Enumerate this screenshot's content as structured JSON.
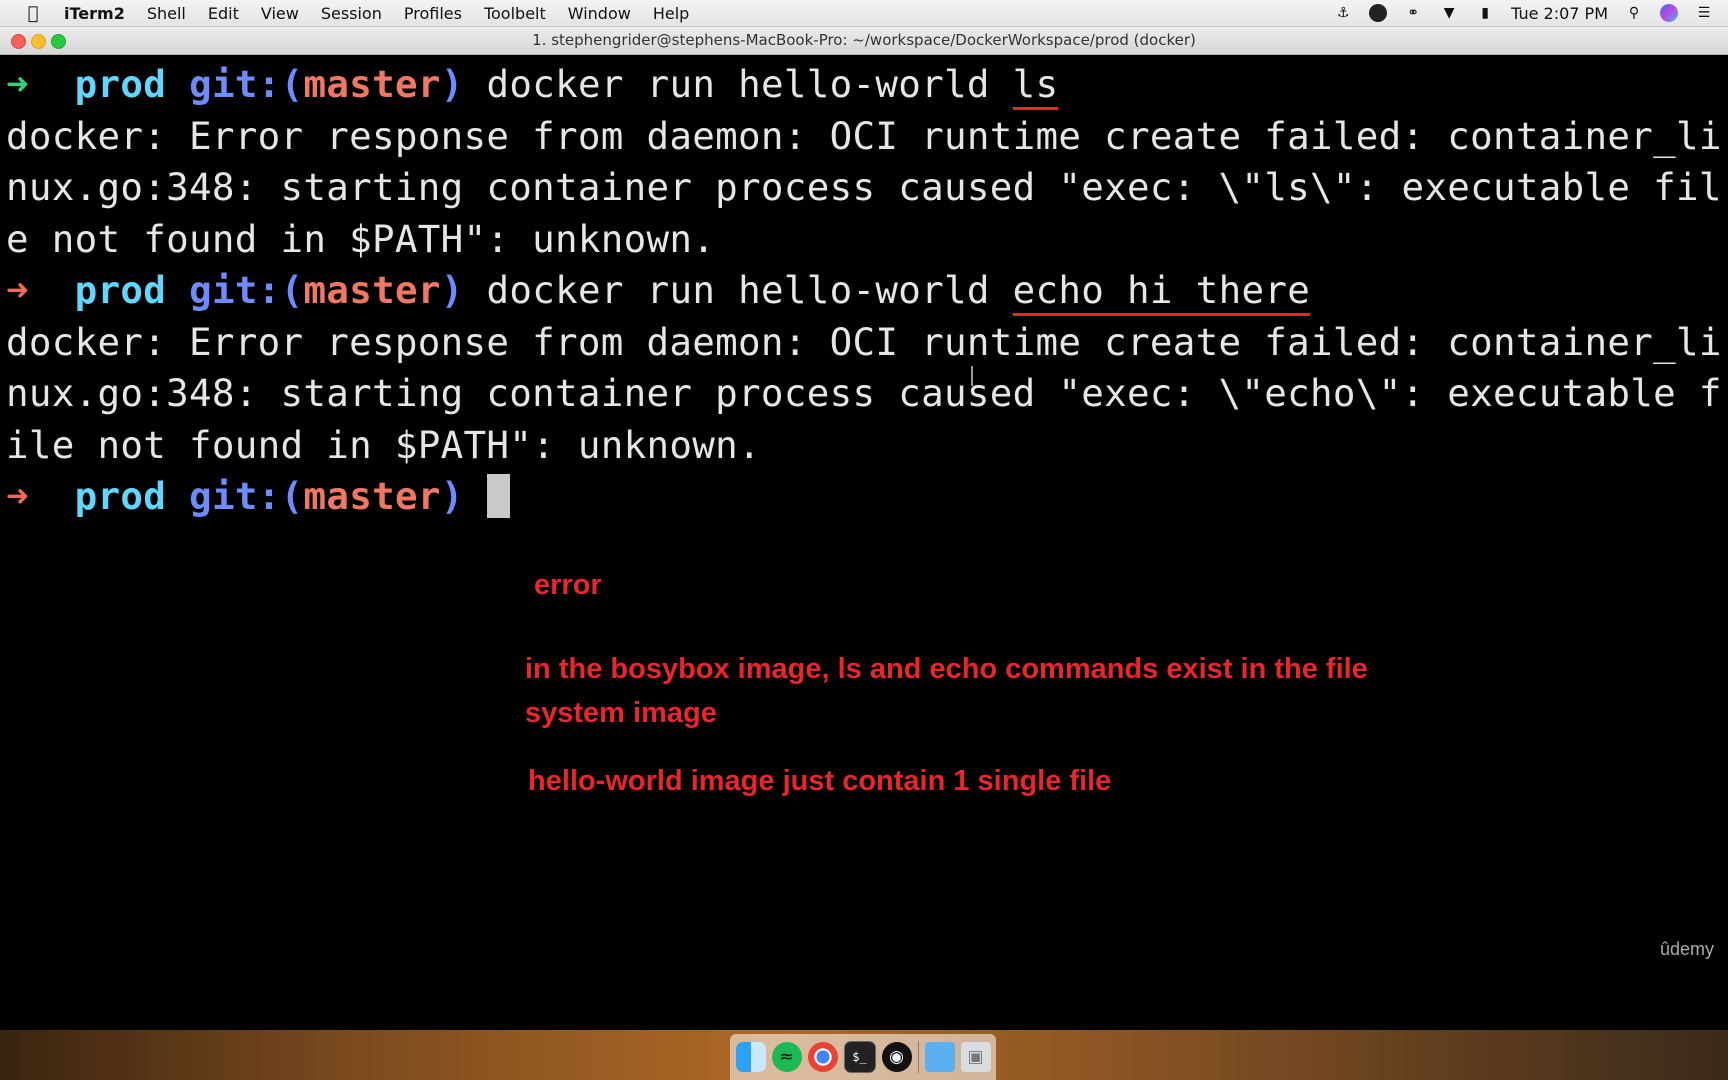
{
  "menubar": {
    "apple_icon": "apple-icon",
    "items": [
      "iTerm2",
      "Shell",
      "Edit",
      "View",
      "Session",
      "Profiles",
      "Toolbelt",
      "Window",
      "Help"
    ],
    "clock": "Tue 2:07 PM",
    "status_icons": [
      "docker-icon",
      "obs-icon",
      "glasses-icon",
      "wifi-icon",
      "battery-icon",
      "search-icon",
      "siri-icon",
      "list-icon"
    ]
  },
  "window": {
    "title": "1. stephengrider@stephens-MacBook-Pro: ~/workspace/DockerWorkspace/prod (docker)"
  },
  "terminal": {
    "prompt": {
      "arrow": "➜",
      "dir": "prod",
      "git_prefix": "git:(",
      "branch": "master",
      "git_suffix": ")"
    },
    "cmd1_base": "docker run hello-world ",
    "cmd1_arg": "ls",
    "err1_l1": "docker: Error response from daemon: OCI runtime create failed: container_li",
    "err1_l2": "nux.go:348: starting container process caused \"exec: \\\"ls\\\": executable fil",
    "err1_l3": "e not found in $PATH\": unknown.",
    "cmd2_base": "docker run hello-world ",
    "cmd2_arg": "echo hi there",
    "err2_l1": "docker: Error response from daemon: OCI runtime create failed: container_li",
    "err2_l2": "nux.go:348: starting container process caused \"exec: \\\"echo\\\": executable f",
    "err2_l3": "ile not found in $PATH\": unknown."
  },
  "annotations": {
    "note1": "error",
    "note2": "in the bosybox image, ls and echo commands exist in the file system image",
    "note3": "hello-world image just contain 1 single file"
  },
  "watermark": "ûdemy",
  "colors": {
    "annotation": "#e8262b",
    "prompt_arrow_success": "#33d17a",
    "prompt_arrow_error": "#f06a5b",
    "dir": "#5fd7ff",
    "git": "#6d8cff",
    "branch": "#f07863"
  },
  "dock": [
    "finder-icon",
    "spotify-icon",
    "chrome-icon",
    "terminal-icon",
    "obs-icon",
    "folder-icon",
    "trash-icon"
  ]
}
